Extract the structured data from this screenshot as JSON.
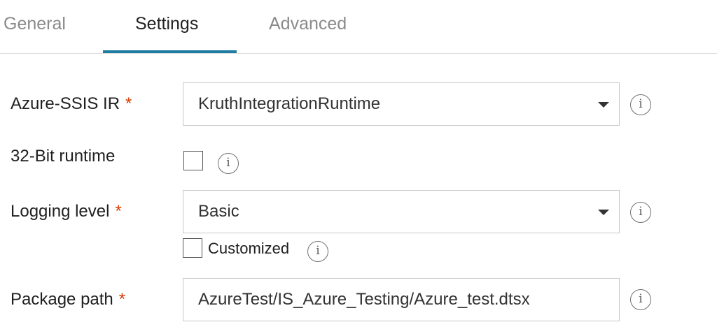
{
  "tabs": [
    {
      "label": "General",
      "active": false
    },
    {
      "label": "Settings",
      "active": true
    },
    {
      "label": "Advanced",
      "active": false
    }
  ],
  "form": {
    "required_mark": "*",
    "info_glyph": "i",
    "azure_ssis_ir": {
      "label": "Azure-SSIS IR",
      "value": "KruthIntegrationRuntime"
    },
    "bit32_runtime": {
      "label": "32-Bit runtime",
      "checked": false
    },
    "logging_level": {
      "label": "Logging level",
      "value": "Basic",
      "customized_label": "Customized",
      "customized_checked": false
    },
    "package_path": {
      "label": "Package path",
      "value": "AzureTest/IS_Azure_Testing/Azure_test.dtsx"
    }
  },
  "colors": {
    "accent": "#1f7da3",
    "required": "#d83b01"
  }
}
